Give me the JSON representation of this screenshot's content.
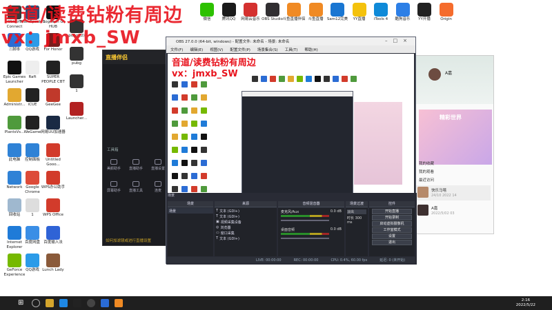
{
  "overlay": {
    "line1": "音道/读费钻粉有周边",
    "line2": "vx：jmxb_SW"
  },
  "desktop_left": [
    {
      "label": "Ubisoft Connect",
      "icon": "ubisoft-icon",
      "color": "#3a3a3a"
    },
    {
      "label": "三脚本",
      "icon": "app-icon",
      "color": "#2b6cd4"
    },
    {
      "label": "Epic Games Launcher",
      "icon": "epic-icon",
      "color": "#111111"
    },
    {
      "label": "Administr...",
      "icon": "user-folder-icon",
      "color": "#e2a830"
    },
    {
      "label": "PlantsVs...",
      "icon": "plants-vs-zombies-icon",
      "color": "#4f9a3c"
    },
    {
      "label": "此电脑",
      "icon": "computer-icon",
      "color": "#2f82d6"
    },
    {
      "label": "Network",
      "icon": "network-icon",
      "color": "#2f82d6"
    },
    {
      "label": "回收站",
      "icon": "recycle-bin-icon",
      "color": "#9fb8cf"
    },
    {
      "label": "Internet Explorer",
      "icon": "ie-icon",
      "color": "#1f7bd8"
    },
    {
      "label": "GeForce Experience",
      "icon": "geforce-icon",
      "color": "#76b900"
    }
  ],
  "desktop_col2": [
    {
      "label": "TeamSpeak 3",
      "icon": "teamspeak-icon",
      "color": "#25507c"
    },
    {
      "label": "QQ游戏",
      "icon": "qq-game-icon",
      "color": "#2b9be8"
    },
    {
      "label": "Raft",
      "icon": "raft-icon",
      "color": "#eeeeee"
    },
    {
      "label": "iCUE",
      "icon": "icue-icon",
      "color": "#222222"
    },
    {
      "label": "WeGame",
      "icon": "wegame-icon",
      "color": "#222222"
    },
    {
      "label": "控制面板",
      "icon": "control-panel-icon",
      "color": "#2f82d6"
    },
    {
      "label": "Google Chrome",
      "icon": "chrome-icon",
      "color": "#dd4b39"
    },
    {
      "label": "1",
      "icon": "file-icon",
      "color": "#dddddd"
    },
    {
      "label": "百度网盘",
      "icon": "baidu-netdisk-icon",
      "color": "#3a8ee6"
    },
    {
      "label": "QQ游戏",
      "icon": "qq-game-icon",
      "color": "#2b9be8"
    }
  ],
  "desktop_col3": [
    {
      "label": "Logitech G HUB",
      "icon": "logitech-icon",
      "color": "#111111"
    },
    {
      "label": "For Honor",
      "icon": "for-honor-icon",
      "color": "#7a1b1b"
    },
    {
      "label": "SUPER PEOPLE CBT",
      "icon": "super-people-icon",
      "color": "#222222"
    },
    {
      "label": "GeeGee",
      "icon": "geegee-icon",
      "color": "#c0392b"
    },
    {
      "label": "网易UU加速器",
      "icon": "uu-accelerator-icon",
      "color": "#1a2a44"
    },
    {
      "label": "Untitled Gooo...",
      "icon": "untitled-icon",
      "color": "#d23b2b"
    },
    {
      "label": "WPS办公助手",
      "icon": "wps-icon",
      "color": "#d23b2b"
    },
    {
      "label": "WPS Office",
      "icon": "wps-office-icon",
      "color": "#d23b2b"
    },
    {
      "label": "百度输入法",
      "icon": "baidu-input-icon",
      "color": "#2f63d6"
    },
    {
      "label": "Lunch Lady",
      "icon": "lunch-lady-icon",
      "color": "#8a5a3a"
    }
  ],
  "desktop_col4": [
    {
      "label": "pubg (2)",
      "icon": "pubg-icon",
      "color": "#333333"
    },
    {
      "label": "pubg",
      "icon": "pubg-icon",
      "color": "#333333"
    },
    {
      "label": "1",
      "icon": "file-icon",
      "color": "#333333"
    },
    {
      "label": "Launcher...",
      "icon": "launcher-icon",
      "color": "#b22222"
    }
  ],
  "top_row": [
    {
      "label": "微信",
      "icon": "wechat-icon",
      "color": "#2dc100"
    },
    {
      "label": "腾讯QQ",
      "icon": "qq-icon",
      "color": "#1a1a1a"
    },
    {
      "label": "网易云音乐",
      "icon": "netease-music-icon",
      "color": "#d4312f"
    },
    {
      "label": "OBS Studio",
      "icon": "obs-icon",
      "color": "#302e31"
    },
    {
      "label": "斗鱼直播伴侣",
      "icon": "douyu-icon",
      "color": "#f08a24"
    },
    {
      "label": "斗鱼直播",
      "icon": "douyu-live-icon",
      "color": "#f08a24"
    },
    {
      "label": "Sam12完美",
      "icon": "sam-icon",
      "color": "#1976d2"
    },
    {
      "label": "YY直播",
      "icon": "yy-icon",
      "color": "#f4c20d"
    },
    {
      "label": "iTools 4",
      "icon": "itools-icon",
      "color": "#0f8ad8"
    },
    {
      "label": "酷狗音乐",
      "icon": "kugou-icon",
      "color": "#2d7fe6"
    },
    {
      "label": "YY开播",
      "icon": "yy-live-icon",
      "color": "#222222"
    },
    {
      "label": "Origin",
      "icon": "origin-icon",
      "color": "#f56c2d"
    }
  ],
  "streaming_app": {
    "logo": "直播伴侣",
    "side_label": "工具箱",
    "buttons": [
      "美颜助手",
      "直播助手",
      "直播设置",
      "屏幕助手",
      "直播工具",
      "连麦"
    ],
    "notice": "如何加滤镜或进行直播设置"
  },
  "obs": {
    "title": "OBS 27.0.0 (64-bit, windows) - 配置文件: 未命名 - 场景: 未命名",
    "menus": [
      "文件(F)",
      "编辑(E)",
      "视图(V)",
      "配置文件(P)",
      "场景集合(S)",
      "工具(T)",
      "帮助(H)"
    ],
    "docks": [
      "场景",
      "来源",
      "音频混音器",
      "场景过渡",
      "控件"
    ],
    "scene_item": "场景",
    "sources": [
      "文本 (GDI+)",
      "文本 (GDI+)",
      "视频采集设备",
      "浏览器",
      "窗口采集",
      "文本 (GDI+)"
    ],
    "mixer": [
      {
        "name": "麦克风/Aux",
        "db": "0.0 dB"
      },
      {
        "name": "桌面音频",
        "db": "0.0 dB"
      }
    ],
    "transition": {
      "type": "淡出",
      "duration_label": "时长",
      "duration": "300 ms"
    },
    "controls": [
      "开始直播",
      "开始录制",
      "启动虚拟摄像机",
      "工作室模式",
      "设置",
      "退出"
    ],
    "status": {
      "live": "LIVE: 00:00:00",
      "rec": "REC: 00:00:00",
      "cpu": "CPU: 0.4%, 60.00 fps",
      "right": "延迟: 0 (未开始)"
    }
  },
  "chat_app": {
    "name": "A嘉",
    "banner": "精彩世界",
    "menu": [
      "我的收藏",
      "我的观看",
      "最近访问"
    ],
    "rows": [
      {
        "title": "快乐马嘻",
        "sub": "24/10 2022  14"
      },
      {
        "title": "A嘉",
        "sub": "2022/5/02  03"
      }
    ]
  },
  "taskbar": {
    "time": "2:16",
    "date": "2022/5/22"
  }
}
